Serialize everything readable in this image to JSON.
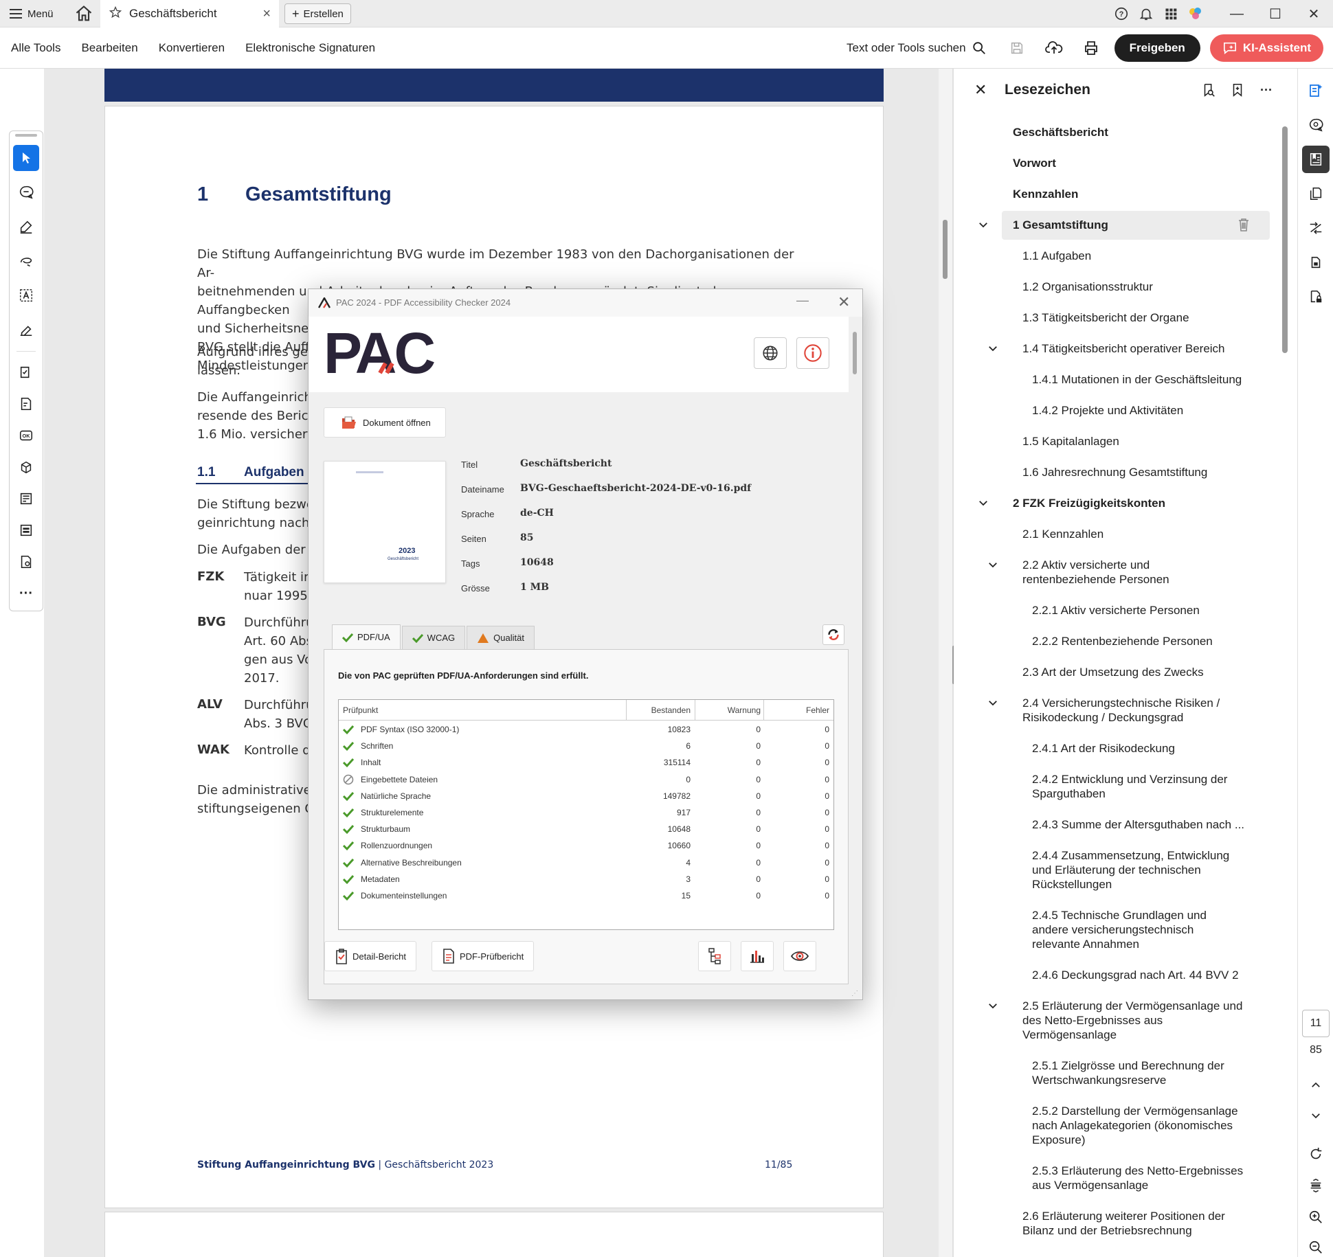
{
  "tabbar": {
    "menu_label": "Menü",
    "tab_title": "Geschäftsbericht",
    "create_label": "Erstellen"
  },
  "toolbar": {
    "menus": [
      "Alle Tools",
      "Bearbeiten",
      "Konvertieren",
      "Elektronische Signaturen"
    ],
    "search_label": "Text oder Tools suchen",
    "share_label": "Freigeben",
    "ai_label": "KI-Assistent",
    "ai_color": "#ef5b5b"
  },
  "document": {
    "h1_num": "1",
    "h1_text": "Gesamtstiftung",
    "para1": [
      "Die Stiftung Auffangeinrichtung BVG wurde im Dezember 1983 von den Dachorganisationen der Ar-",
      "beitnehmenden und Arbeitgebenden im Auftrag des Bundes gegründet. Sie dient als Auffangbecken",
      "und Sicherheitsnetz",
      "BVG stellt die Auffa",
      "Mindestleistungen"
    ],
    "para2": [
      "Aufgrund ihres gese",
      "lassen."
    ],
    "para3": [
      "Die Auffangeinricht",
      "resende des Berich",
      "1.6 Mio. versicherte"
    ],
    "h2_num": "1.1",
    "h2_text": "Aufgaben",
    "para4": [
      "Die Stiftung bezwec",
      "geinrichtung nach A"
    ],
    "para5": "Die Aufgaben der A",
    "abbr": [
      {
        "k": "FZK",
        "lines": [
          "Tätigkeit im",
          "nuar 1995."
        ]
      },
      {
        "k": "BVG",
        "lines": [
          "Durchführu",
          "Art. 60 Abs",
          "gen aus Vo",
          "2017."
        ]
      },
      {
        "k": "ALV",
        "lines": [
          "Durchführu",
          "Abs. 3 BVG"
        ]
      },
      {
        "k": "WAK",
        "lines": [
          "Kontrolle d"
        ]
      }
    ],
    "para6": [
      "Die administrativer",
      "stiftungseigenen O"
    ],
    "footer_org": "Stiftung Auffangeinrichtung BVG",
    "footer_sep": " | ",
    "footer_rep": "Geschäftsbericht 2023",
    "footer_page": "11/85",
    "brand_color": "#1c326b"
  },
  "bookmarks": {
    "title": "Lesezeichen",
    "items": [
      {
        "label": "Geschäftsbericht",
        "level": 0,
        "bold": true
      },
      {
        "label": "Vorwort",
        "level": 0,
        "bold": true
      },
      {
        "label": "Kennzahlen",
        "level": 0,
        "bold": true
      },
      {
        "label": "1 Gesamtstiftung",
        "level": 0,
        "bold": true,
        "chev": true,
        "selected": true
      },
      {
        "label": "1.1 Aufgaben",
        "level": 1
      },
      {
        "label": "1.2 Organisationsstruktur",
        "level": 1
      },
      {
        "label": "1.3 Tätigkeitsbericht der Organe",
        "level": 1
      },
      {
        "label": "1.4 Tätigkeitsbericht operativer Bereich",
        "level": 1,
        "chev": true
      },
      {
        "label": "1.4.1 Mutationen in der Geschäftsleitung",
        "level": 2
      },
      {
        "label": "1.4.2 Projekte und Aktivitäten",
        "level": 2
      },
      {
        "label": "1.5 Kapitalanlagen",
        "level": 1
      },
      {
        "label": "1.6 Jahresrechnung Gesamtstiftung",
        "level": 1
      },
      {
        "label": "2 FZK Freizügigkeitskonten",
        "level": 0,
        "bold": true,
        "chev": true
      },
      {
        "label": "2.1 Kennzahlen",
        "level": 1
      },
      {
        "label": "2.2 Aktiv versicherte und\nrentenbeziehende Personen",
        "level": 1,
        "chev": true
      },
      {
        "label": "2.2.1 Aktiv versicherte Personen",
        "level": 2
      },
      {
        "label": "2.2.2 Rentenbeziehende Personen",
        "level": 2
      },
      {
        "label": "2.3 Art der Umsetzung des Zwecks",
        "level": 1
      },
      {
        "label": "2.4 Versicherungstechnische Risiken /\nRisikodeckung / Deckungsgrad",
        "level": 1,
        "chev": true
      },
      {
        "label": "2.4.1 Art der Risikodeckung",
        "level": 2
      },
      {
        "label": "2.4.2 Entwicklung und Verzinsung der\nSparguthaben",
        "level": 2
      },
      {
        "label": "2.4.3 Summe der Altersguthaben nach ...",
        "level": 2
      },
      {
        "label": "2.4.4 Zusammensetzung, Entwicklung\nund Erläuterung der technischen\nRückstellungen",
        "level": 2
      },
      {
        "label": "2.4.5 Technische Grundlagen und\nandere versicherungstechnisch\nrelevante Annahmen",
        "level": 2
      },
      {
        "label": "2.4.6 Deckungsgrad nach Art. 44 BVV 2",
        "level": 2
      },
      {
        "label": "2.5 Erläuterung der Vermögensanlage und\ndes Netto-Ergebnisses aus\nVermögensanlage",
        "level": 1,
        "chev": true
      },
      {
        "label": "2.5.1 Zielgrösse und Berechnung der\nWertschwankungsreserve",
        "level": 2
      },
      {
        "label": "2.5.2 Darstellung der Vermögensanlage\nnach Anlagekategorien (ökonomisches\nExposure)",
        "level": 2
      },
      {
        "label": "2.5.3 Erläuterung des Netto-Ergebnisses\naus Vermögensanlage",
        "level": 2
      },
      {
        "label": "2.6 Erläuterung weiterer Positionen der\nBilanz und der Betriebsrechnung",
        "level": 1
      }
    ]
  },
  "pager": {
    "current": "11",
    "total": "85"
  },
  "pac": {
    "window_title": "PAC 2024 - PDF Accessibility Checker 2024",
    "logo_text": "PAC",
    "open_label": "Dokument öffnen",
    "thumb_year": "2023",
    "thumb_sub": "Geschäftsbericht",
    "meta": [
      {
        "k": "Titel",
        "v": "Geschäftsbericht"
      },
      {
        "k": "Dateiname",
        "v": "BVG-Geschaeftsbericht-2024-DE-v0-16.pdf"
      },
      {
        "k": "Sprache",
        "v": "de-CH"
      },
      {
        "k": "Seiten",
        "v": "85"
      },
      {
        "k": "Tags",
        "v": "10648"
      },
      {
        "k": "Grösse",
        "v": "1 MB"
      }
    ],
    "tabs": [
      {
        "label": "PDF/UA",
        "icon": "check-icon",
        "active": true
      },
      {
        "label": "WCAG",
        "icon": "check-icon"
      },
      {
        "label": "Qualität",
        "icon": "warning-icon"
      }
    ],
    "message": "Die von PAC geprüften PDF/UA-Anforderungen sind erfüllt.",
    "columns": [
      "Prüfpunkt",
      "Bestanden",
      "Warnung",
      "Fehler"
    ],
    "rows": [
      {
        "name": "PDF Syntax (ISO 32000-1)",
        "passed": "10823",
        "warn": "0",
        "err": "0",
        "status": "ok"
      },
      {
        "name": "Schriften",
        "passed": "6",
        "warn": "0",
        "err": "0",
        "status": "ok"
      },
      {
        "name": "Inhalt",
        "passed": "315114",
        "warn": "0",
        "err": "0",
        "status": "ok"
      },
      {
        "name": "Eingebettete Dateien",
        "passed": "0",
        "warn": "0",
        "err": "0",
        "status": "na"
      },
      {
        "name": "Natürliche Sprache",
        "passed": "149782",
        "warn": "0",
        "err": "0",
        "status": "ok"
      },
      {
        "name": "Strukturelemente",
        "passed": "917",
        "warn": "0",
        "err": "0",
        "status": "ok"
      },
      {
        "name": "Strukturbaum",
        "passed": "10648",
        "warn": "0",
        "err": "0",
        "status": "ok"
      },
      {
        "name": "Rollenzuordnungen",
        "passed": "10660",
        "warn": "0",
        "err": "0",
        "status": "ok"
      },
      {
        "name": "Alternative Beschreibungen",
        "passed": "4",
        "warn": "0",
        "err": "0",
        "status": "ok"
      },
      {
        "name": "Metadaten",
        "passed": "3",
        "warn": "0",
        "err": "0",
        "status": "ok"
      },
      {
        "name": "Dokumenteinstellungen",
        "passed": "15",
        "warn": "0",
        "err": "0",
        "status": "ok"
      }
    ],
    "detail_label": "Detail-Bericht",
    "pdf_report_label": "PDF-Prüfbericht",
    "ok_color": "#4a9a2a",
    "warn_color": "#e07a1f",
    "accent_color": "#e0463a"
  }
}
